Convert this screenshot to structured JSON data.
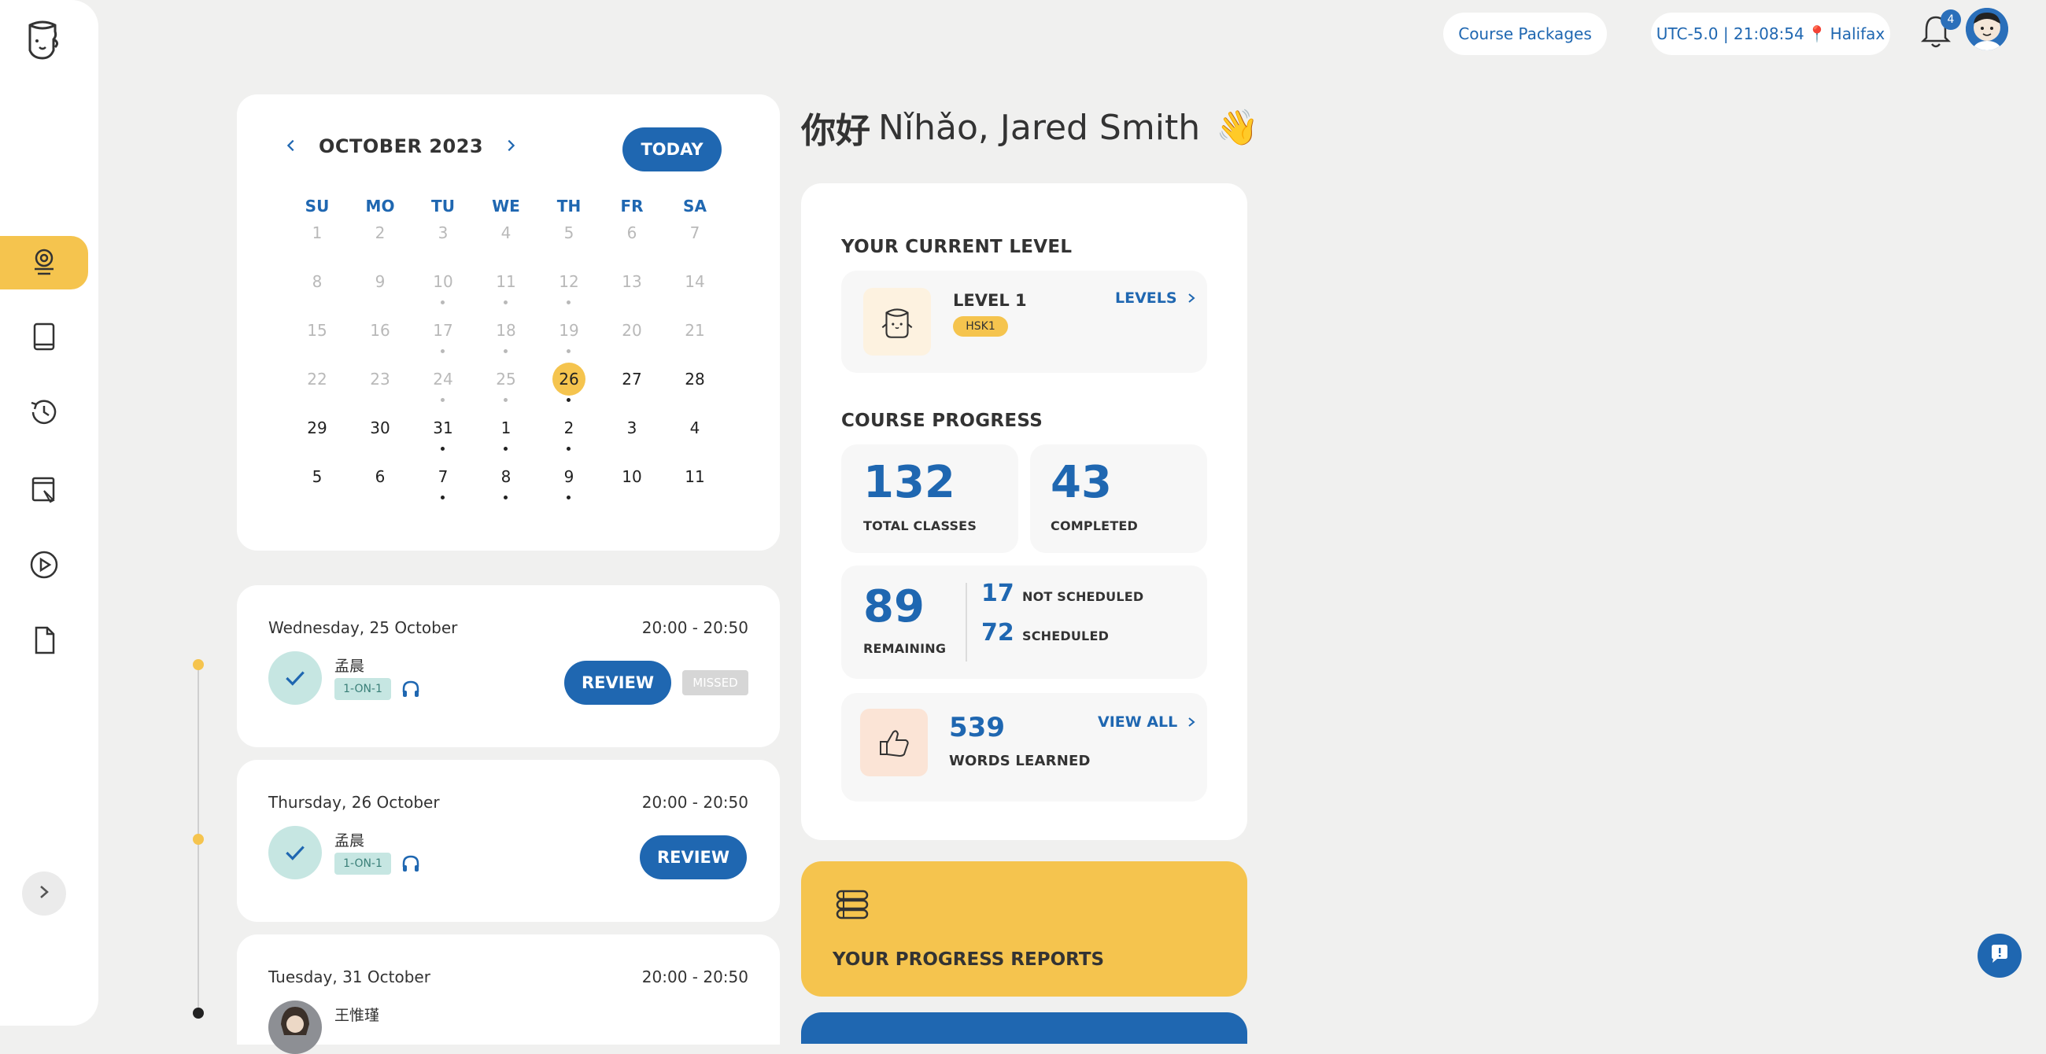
{
  "header": {
    "course_packages": "Course Packages",
    "timezone": "UTC-5.0 | 21:08:54 ",
    "city": "Halifax",
    "notifications": "4"
  },
  "calendar": {
    "title": "OCTOBER 2023",
    "today": "TODAY",
    "weekdays": [
      "SU",
      "MO",
      "TU",
      "WE",
      "TH",
      "FR",
      "SA"
    ],
    "weeks": [
      [
        "1",
        "2",
        "3",
        "4",
        "5",
        "6",
        "7"
      ],
      [
        "8",
        "9",
        "10",
        "11",
        "12",
        "13",
        "14"
      ],
      [
        "15",
        "16",
        "17",
        "18",
        "19",
        "20",
        "21"
      ],
      [
        "22",
        "23",
        "24",
        "25",
        "26",
        "27",
        "28"
      ],
      [
        "29",
        "30",
        "31",
        "1",
        "2",
        "3",
        "4"
      ],
      [
        "5",
        "6",
        "7",
        "8",
        "9",
        "10",
        "11"
      ]
    ],
    "selected": "26"
  },
  "lessons": [
    {
      "date": "Wednesday, 25 October",
      "time": "20:00 - 20:50",
      "teacher": "孟晨",
      "type": "1-ON-1",
      "action": "REVIEW",
      "status": "MISSED"
    },
    {
      "date": "Thursday, 26 October",
      "time": "20:00 - 20:50",
      "teacher": "孟晨",
      "type": "1-ON-1",
      "action": "REVIEW"
    },
    {
      "date": "Tuesday, 31 October",
      "time": "20:00 - 20:50",
      "teacher": "王惟瑾"
    }
  ],
  "greeting": {
    "hanzi": "你好",
    "text": "Nǐhǎo, Jared Smith",
    "emoji": "👋"
  },
  "level": {
    "section_title": "YOUR CURRENT LEVEL",
    "name": "LEVEL 1",
    "badge": "HSK1",
    "link": "LEVELS"
  },
  "progress": {
    "section_title": "COURSE PROGRESS",
    "total_classes": "132",
    "total_classes_label": "TOTAL CLASSES",
    "completed": "43",
    "completed_label": "COMPLETED",
    "remaining": "89",
    "remaining_label": "REMAINING",
    "not_scheduled": "17",
    "not_scheduled_label": "NOT SCHEDULED",
    "scheduled": "72",
    "scheduled_label": "SCHEDULED",
    "words": "539",
    "words_label": "WORDS LEARNED",
    "view_all": "VIEW ALL"
  },
  "reports": {
    "title": "YOUR PROGRESS REPORTS"
  },
  "colors": {
    "accent_blue": "#1f67b1",
    "accent_yellow": "#f5c44e",
    "background": "#f0f0ef"
  },
  "icons": [
    "logo-icon",
    "dashboard-icon",
    "book-icon",
    "history-icon",
    "homework-icon",
    "video-icon",
    "document-icon",
    "chevron-right-icon",
    "bell-icon",
    "checkmark-icon",
    "headset-icon",
    "chat-icon"
  ]
}
